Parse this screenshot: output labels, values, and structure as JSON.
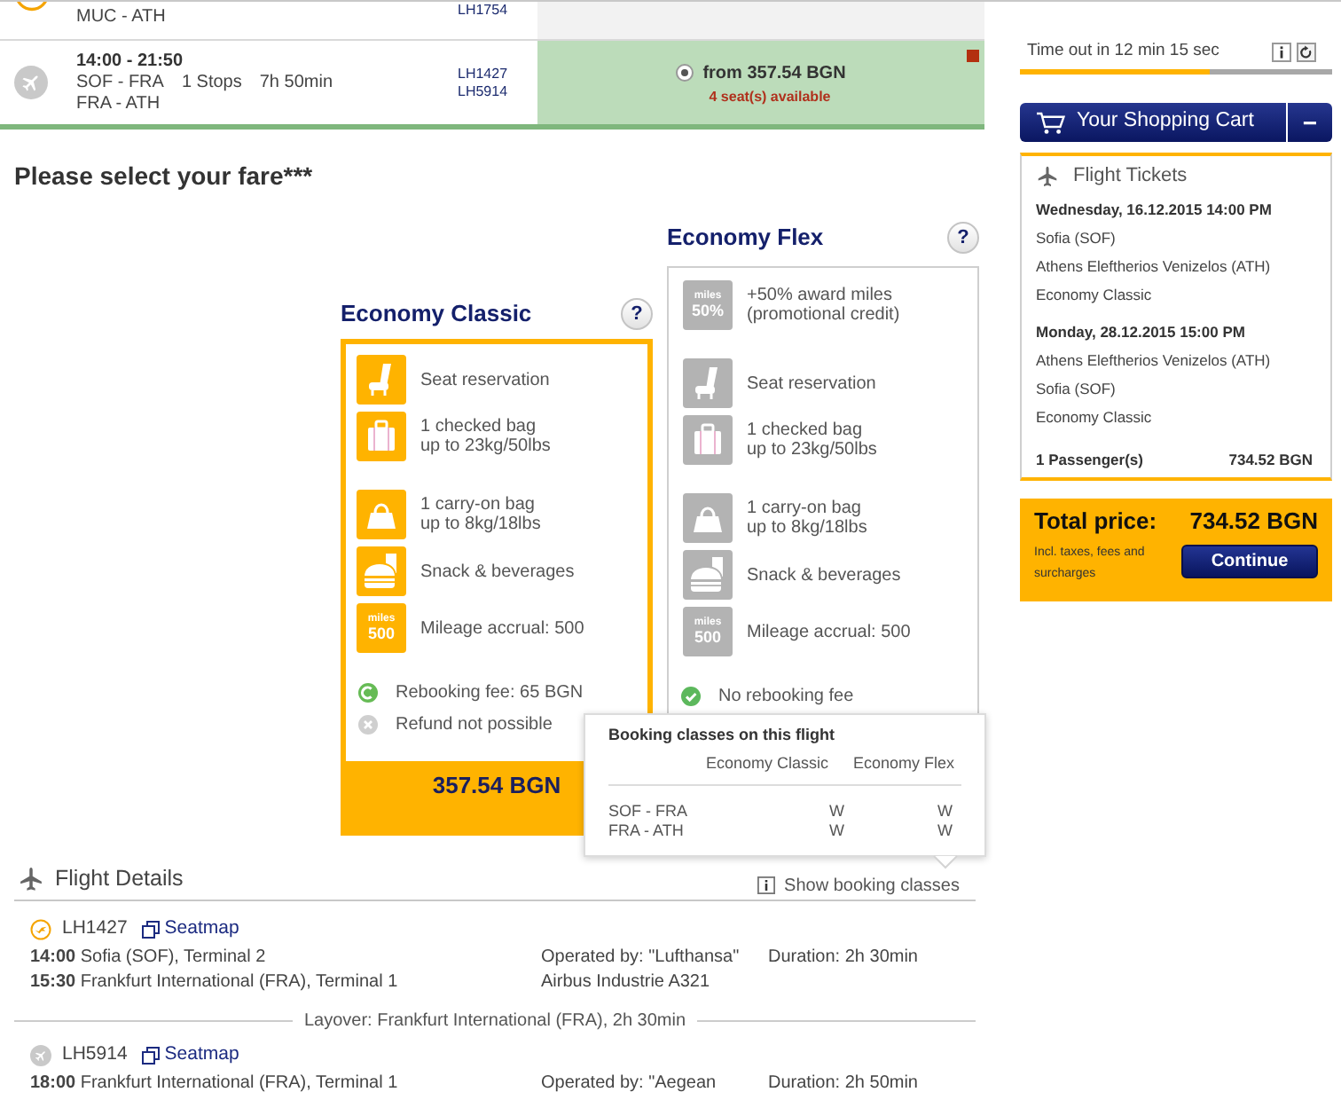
{
  "results": [
    {
      "kind": "partial",
      "logo": {
        "kind": "crane"
      },
      "route_lines": [
        "MUC - ATH"
      ],
      "flight_numbers": [
        "LH1754"
      ],
      "selected": false
    },
    {
      "kind": "full",
      "logo": {
        "kind": "plane"
      },
      "times": "14:00 - 21:50",
      "route_lines": [
        "SOF - FRA",
        "FRA - ATH"
      ],
      "stops": "1 Stops",
      "duration": "7h 50min",
      "flight_numbers": [
        "LH1427",
        "LH5914"
      ],
      "price": "from 357.54 BGN",
      "availability": "4 seat(s) available",
      "selected": true
    }
  ],
  "fare_heading": "Please select your fare***",
  "fares": [
    {
      "name": "Economy Classic",
      "help": "?",
      "selected": true,
      "features": [
        {
          "kind": "seat",
          "lines": [
            "Seat reservation"
          ]
        },
        {
          "kind": "bag",
          "lines": [
            "1 checked bag",
            "up to 23kg/50lbs"
          ]
        },
        {
          "kind": "carry-on",
          "lines": [
            "1 carry-on bag",
            "up to 8kg/18lbs"
          ]
        },
        {
          "kind": "meal",
          "lines": [
            "Snack & beverages"
          ]
        },
        {
          "kind": "miles",
          "badge": [
            "miles",
            "500"
          ],
          "lines": [
            "Mileage accrual: 500"
          ]
        }
      ],
      "conditions": [
        {
          "kind": "fee",
          "text": "Rebooking fee: 65 BGN"
        },
        {
          "kind": "excluded",
          "text": "Refund not possible"
        }
      ],
      "price": "357.54 BGN"
    },
    {
      "name": "Economy Flex",
      "help": "?",
      "selected": false,
      "features": [
        {
          "kind": "bonus",
          "badge": [
            "miles",
            "50%"
          ],
          "lines": [
            "+50% award miles",
            "(promotional credit)"
          ]
        },
        {
          "kind": "seat",
          "lines": [
            "Seat reservation"
          ]
        },
        {
          "kind": "bag",
          "lines": [
            "1 checked bag",
            "up to 23kg/50lbs"
          ]
        },
        {
          "kind": "carry-on",
          "lines": [
            "1 carry-on bag",
            "up to 8kg/18lbs"
          ]
        },
        {
          "kind": "meal",
          "lines": [
            "Snack & beverages"
          ]
        },
        {
          "kind": "miles",
          "badge": [
            "miles",
            "500"
          ],
          "lines": [
            "Mileage accrual: 500"
          ]
        }
      ],
      "conditions": [
        {
          "kind": "included",
          "text": "No rebooking fee"
        }
      ]
    }
  ],
  "booking_classes": {
    "title": "Booking classes on this flight",
    "columns": [
      "Economy Classic",
      "Economy Flex"
    ],
    "rows": [
      {
        "route": "SOF - FRA",
        "classes": [
          "W",
          "W"
        ]
      },
      {
        "route": "FRA - ATH",
        "classes": [
          "W",
          "W"
        ]
      }
    ]
  },
  "flight_details": {
    "title": "Flight Details",
    "toggle": "Show booking classes",
    "segments": [
      {
        "kind": "leg",
        "logo": {
          "kind": "crane"
        },
        "flight": "LH1427",
        "seatmap": "Seatmap",
        "lines": [
          {
            "text": "**14:00** Sofia (SOF), Terminal 2",
            "detail": "Operated by: \"Lufthansa\"",
            "duration": "Duration: 2h 30min"
          },
          {
            "text": "**15:30** Frankfurt International (FRA), Terminal 1",
            "detail": "Airbus Industrie A321"
          }
        ]
      },
      {
        "kind": "layover",
        "text": "Layover: Frankfurt International (FRA), 2h 30min"
      },
      {
        "kind": "leg",
        "logo": {
          "kind": "plane"
        },
        "flight": "LH5914",
        "seatmap": "Seatmap",
        "lines": [
          {
            "text": "**18:00** Frankfurt International (FRA), Terminal 1",
            "detail": "Operated by: \"Aegean",
            "duration": "Duration: 2h 50min"
          }
        ]
      }
    ]
  },
  "timer": {
    "text": "Time out in 12 min 15 sec",
    "level": 0.61
  },
  "cart": {
    "title": "Your Shopping Cart",
    "collapse": "−",
    "section_title": "Flight Tickets",
    "trips": [
      {
        "date": "Wednesday, 16.12.2015 14:00 PM",
        "from": "Sofia (SOF)",
        "to": "Athens Eleftherios Venizelos (ATH)",
        "fare": "Economy Classic"
      },
      {
        "date": "Monday, 28.12.2015 15:00 PM",
        "from": "Athens Eleftherios Venizelos (ATH)",
        "to": "Sofia (SOF)",
        "fare": "Economy Classic"
      }
    ],
    "passengers": "1 Passenger(s)",
    "subtotal": "734.52 BGN"
  },
  "total": {
    "label": "Total price:",
    "amount": "734.52 BGN",
    "note": "Incl. taxes, fees and surcharges",
    "button": "Continue"
  }
}
